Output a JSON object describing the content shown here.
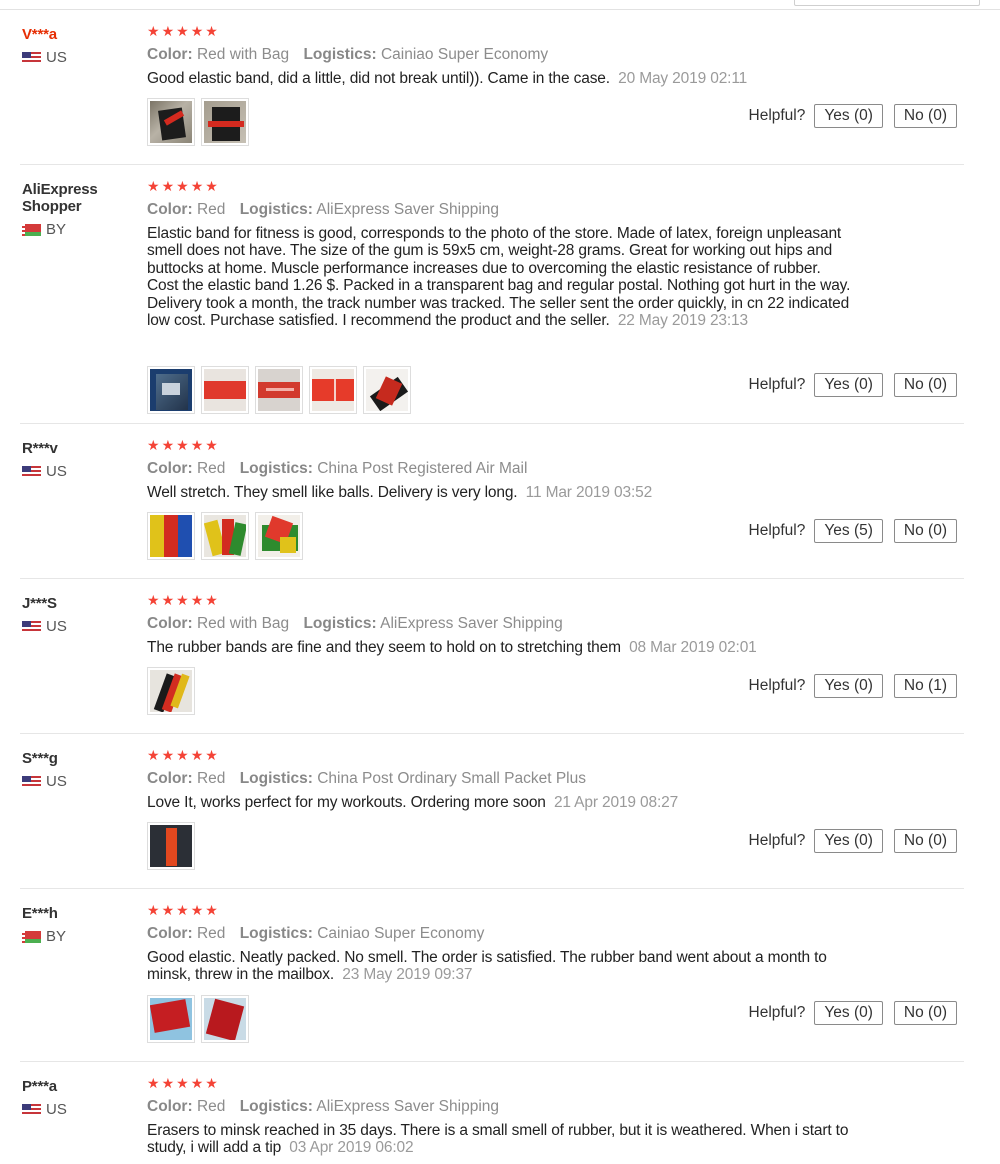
{
  "labels": {
    "color_key": "Color:",
    "logistics_key": "Logistics:",
    "helpful": "Helpful?"
  },
  "colors": {
    "star": "#f44336",
    "accent_name": "#e62e04",
    "meta_text": "#8c8c8c",
    "date_text": "#9a9a9a",
    "divider": "#e6e6e6"
  },
  "reviews": [
    {
      "user": "V***a",
      "country": "US",
      "flag": "us-flag-icon",
      "rating": 5,
      "color": "Red with Bag",
      "logistics": "Cainiao Super Economy",
      "text": "Good elastic band, did a little, did not break until)). Came in the case.",
      "date": "20 May 2019 02:11",
      "photos": 2,
      "yes_label": "Yes (0)",
      "no_label": "No (0)"
    },
    {
      "user": "AliExpress Shopper",
      "country": "BY",
      "flag": "by-flag-icon",
      "rating": 5,
      "color": "Red",
      "logistics": "AliExpress Saver Shipping",
      "text": "Elastic band for fitness is good, corresponds to the photo of the store. Made of latex, foreign unpleasant smell does not have. The size of the gum is 59x5 cm, weight-28 grams. Great for working out hips and buttocks at home. Muscle performance increases due to overcoming the elastic resistance of rubber. Cost the elastic band 1.26 $. Packed in a transparent bag and regular postal. Nothing got hurt in the way. Delivery took a month, the track number was tracked. The seller sent the order quickly, in cn 22 indicated low cost. Purchase satisfied. I recommend the product and the seller.",
      "date": "22 May 2019 23:13",
      "photos": 5,
      "yes_label": "Yes (0)",
      "no_label": "No (0)"
    },
    {
      "user": "R***v",
      "country": "US",
      "flag": "us-flag-icon",
      "rating": 5,
      "color": "Red",
      "logistics": "China Post Registered Air Mail",
      "text": "Well stretch. They smell like balls. Delivery is very long.",
      "date": "11 Mar 2019 03:52",
      "photos": 3,
      "yes_label": "Yes (5)",
      "no_label": "No (0)"
    },
    {
      "user": "J***S",
      "country": "US",
      "flag": "us-flag-icon",
      "rating": 5,
      "color": "Red with Bag",
      "logistics": "AliExpress Saver Shipping",
      "text": "The rubber bands are fine and they seem to hold on to stretching them",
      "date": "08 Mar 2019 02:01",
      "photos": 1,
      "yes_label": "Yes (0)",
      "no_label": "No (1)"
    },
    {
      "user": "S***g",
      "country": "US",
      "flag": "us-flag-icon",
      "rating": 5,
      "color": "Red",
      "logistics": "China Post Ordinary Small Packet Plus",
      "text": "Love It, works perfect for my workouts. Ordering more soon",
      "date": "21 Apr 2019 08:27",
      "photos": 1,
      "yes_label": "Yes (0)",
      "no_label": "No (0)"
    },
    {
      "user": "E***h",
      "country": "BY",
      "flag": "by-flag-icon",
      "rating": 5,
      "color": "Red",
      "logistics": "Cainiao Super Economy",
      "text": "Good elastic. Neatly packed. No smell. The order is satisfied. The rubber band went about a month to minsk, threw in the mailbox.",
      "date": "23 May 2019 09:37",
      "photos": 2,
      "yes_label": "Yes (0)",
      "no_label": "No (0)"
    },
    {
      "user": "P***a",
      "country": "US",
      "flag": "us-flag-icon",
      "rating": 5,
      "color": "Red",
      "logistics": "AliExpress Saver Shipping",
      "text": "Erasers to minsk reached in 35 days. There is a small smell of rubber, but it is weathered. When i start to study, i will add a tip",
      "date": "03 Apr 2019 06:02",
      "photos": 0,
      "yes_label": "",
      "no_label": ""
    }
  ]
}
